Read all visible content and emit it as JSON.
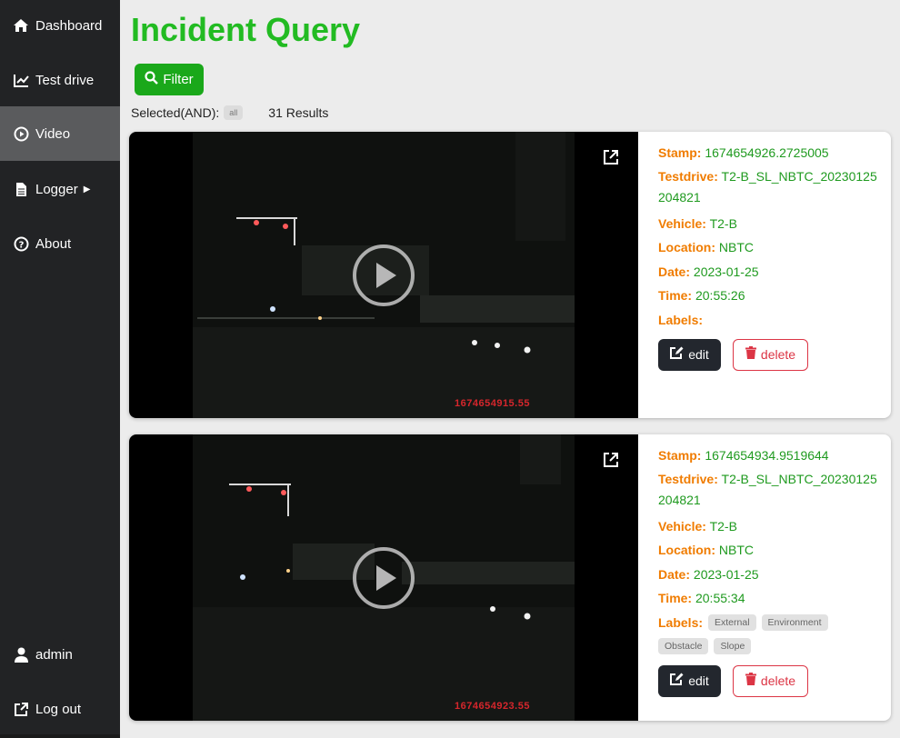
{
  "sidebar": {
    "items": [
      {
        "label": "Dashboard",
        "icon": "home-icon"
      },
      {
        "label": "Test drive",
        "icon": "chart-line-icon"
      },
      {
        "label": "Video",
        "icon": "play-circle-icon",
        "active": true
      },
      {
        "label": "Logger",
        "icon": "file-icon"
      },
      {
        "label": "About",
        "icon": "question-circle-icon"
      }
    ],
    "user": {
      "label": "admin",
      "icon": "user-icon"
    },
    "logout": {
      "label": "Log out",
      "icon": "external-link-icon"
    }
  },
  "header": {
    "title": "Incident Query"
  },
  "filter": {
    "label": "Filter",
    "icon": "search-icon"
  },
  "selection": {
    "label": "Selected(AND):",
    "badge": "all",
    "results": "31 Results"
  },
  "colors": {
    "title": "#22bb22",
    "key": "#f07c00",
    "value": "#1f9a1f",
    "filter_button": "#1aa81a",
    "delete": "#dc3545"
  },
  "incidents": [
    {
      "stamp_label": "Stamp:",
      "stamp": "1674654926.2725005",
      "testdrive_label": "Testdrive:",
      "testdrive": "T2-B_SL_NBTC_20230125204821",
      "vehicle_label": "Vehicle:",
      "vehicle": "T2-B",
      "location_label": "Location:",
      "location": "NBTC",
      "date_label": "Date:",
      "date": "2023-01-25",
      "time_label": "Time:",
      "time": "20:55:26",
      "labels_label": "Labels:",
      "labels": [],
      "video_timestamp": "1674654915.55",
      "edit_label": "edit",
      "delete_label": "delete"
    },
    {
      "stamp_label": "Stamp:",
      "stamp": "1674654934.9519644",
      "testdrive_label": "Testdrive:",
      "testdrive": "T2-B_SL_NBTC_20230125204821",
      "vehicle_label": "Vehicle:",
      "vehicle": "T2-B",
      "location_label": "Location:",
      "location": "NBTC",
      "date_label": "Date:",
      "date": "2023-01-25",
      "time_label": "Time:",
      "time": "20:55:34",
      "labels_label": "Labels:",
      "labels": [
        "External",
        "Environment",
        "Obstacle",
        "Slope"
      ],
      "video_timestamp": "1674654923.55",
      "edit_label": "edit",
      "delete_label": "delete"
    }
  ]
}
